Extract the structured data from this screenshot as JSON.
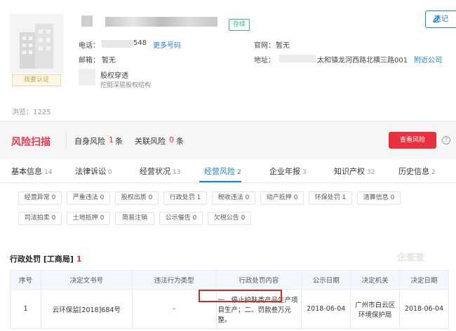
{
  "header": {
    "status": "存续",
    "note_label": "笔记",
    "phone_label": "电话：",
    "phone_value": "548",
    "more_phones": "更多号码",
    "email_label": "邮箱：",
    "email_value": "暂无",
    "website_label": "官网：",
    "website_value": "暂无",
    "address_label": "地址：",
    "address_value": "太和镇龙河西路北横三路001",
    "nearby": "附近公司",
    "equity_title": "股权穿透",
    "equity_sub": "挖掘深层股权结构",
    "claim": "我要认证",
    "views": "浏览：1225"
  },
  "risk": {
    "logo": "风险扫描",
    "self_label": "自身风险",
    "self_count": "1",
    "related_label": "关联风险",
    "related_count": "0",
    "unit": "条",
    "button": "查看风险",
    "help": "?"
  },
  "tabs": [
    {
      "label": "基本信息",
      "count": "14"
    },
    {
      "label": "法律诉讼",
      "count": "0"
    },
    {
      "label": "经营状况",
      "count": "13"
    },
    {
      "label": "经营风险",
      "count": "2"
    },
    {
      "label": "企业年报",
      "count": "3"
    },
    {
      "label": "知识产权",
      "count": "32"
    },
    {
      "label": "历史信息",
      "count": "2"
    }
  ],
  "chips": [
    "经营异常 0",
    "严重违法 0",
    "股权出质 0",
    "行政处罚 1",
    "税收违法 0",
    "动产抵押 0",
    "环保处罚 1",
    "清算信息 0",
    "司法拍卖 0",
    "土地抵押 0",
    "简易注销",
    "公示催告 0",
    "欠税公告 0"
  ],
  "section": {
    "title": "行政处罚 [工商局]",
    "count": "1",
    "watermark": "企查查"
  },
  "table": {
    "headers": [
      "序号",
      "决定文书号",
      "违法行为类型",
      "行政处罚内容",
      "公示日期",
      "决定机关",
      "决定日期"
    ],
    "row": {
      "index": "1",
      "doc_no": "云环保监[2018]684号",
      "violation_type": "-",
      "content": "一、停止护肤类产品生产项目生产；二、罚款叁万元整。",
      "publish_date": "2018-06-04",
      "authority": "广州市白云区环境保护局",
      "decision_date": "2018-06-04"
    }
  }
}
